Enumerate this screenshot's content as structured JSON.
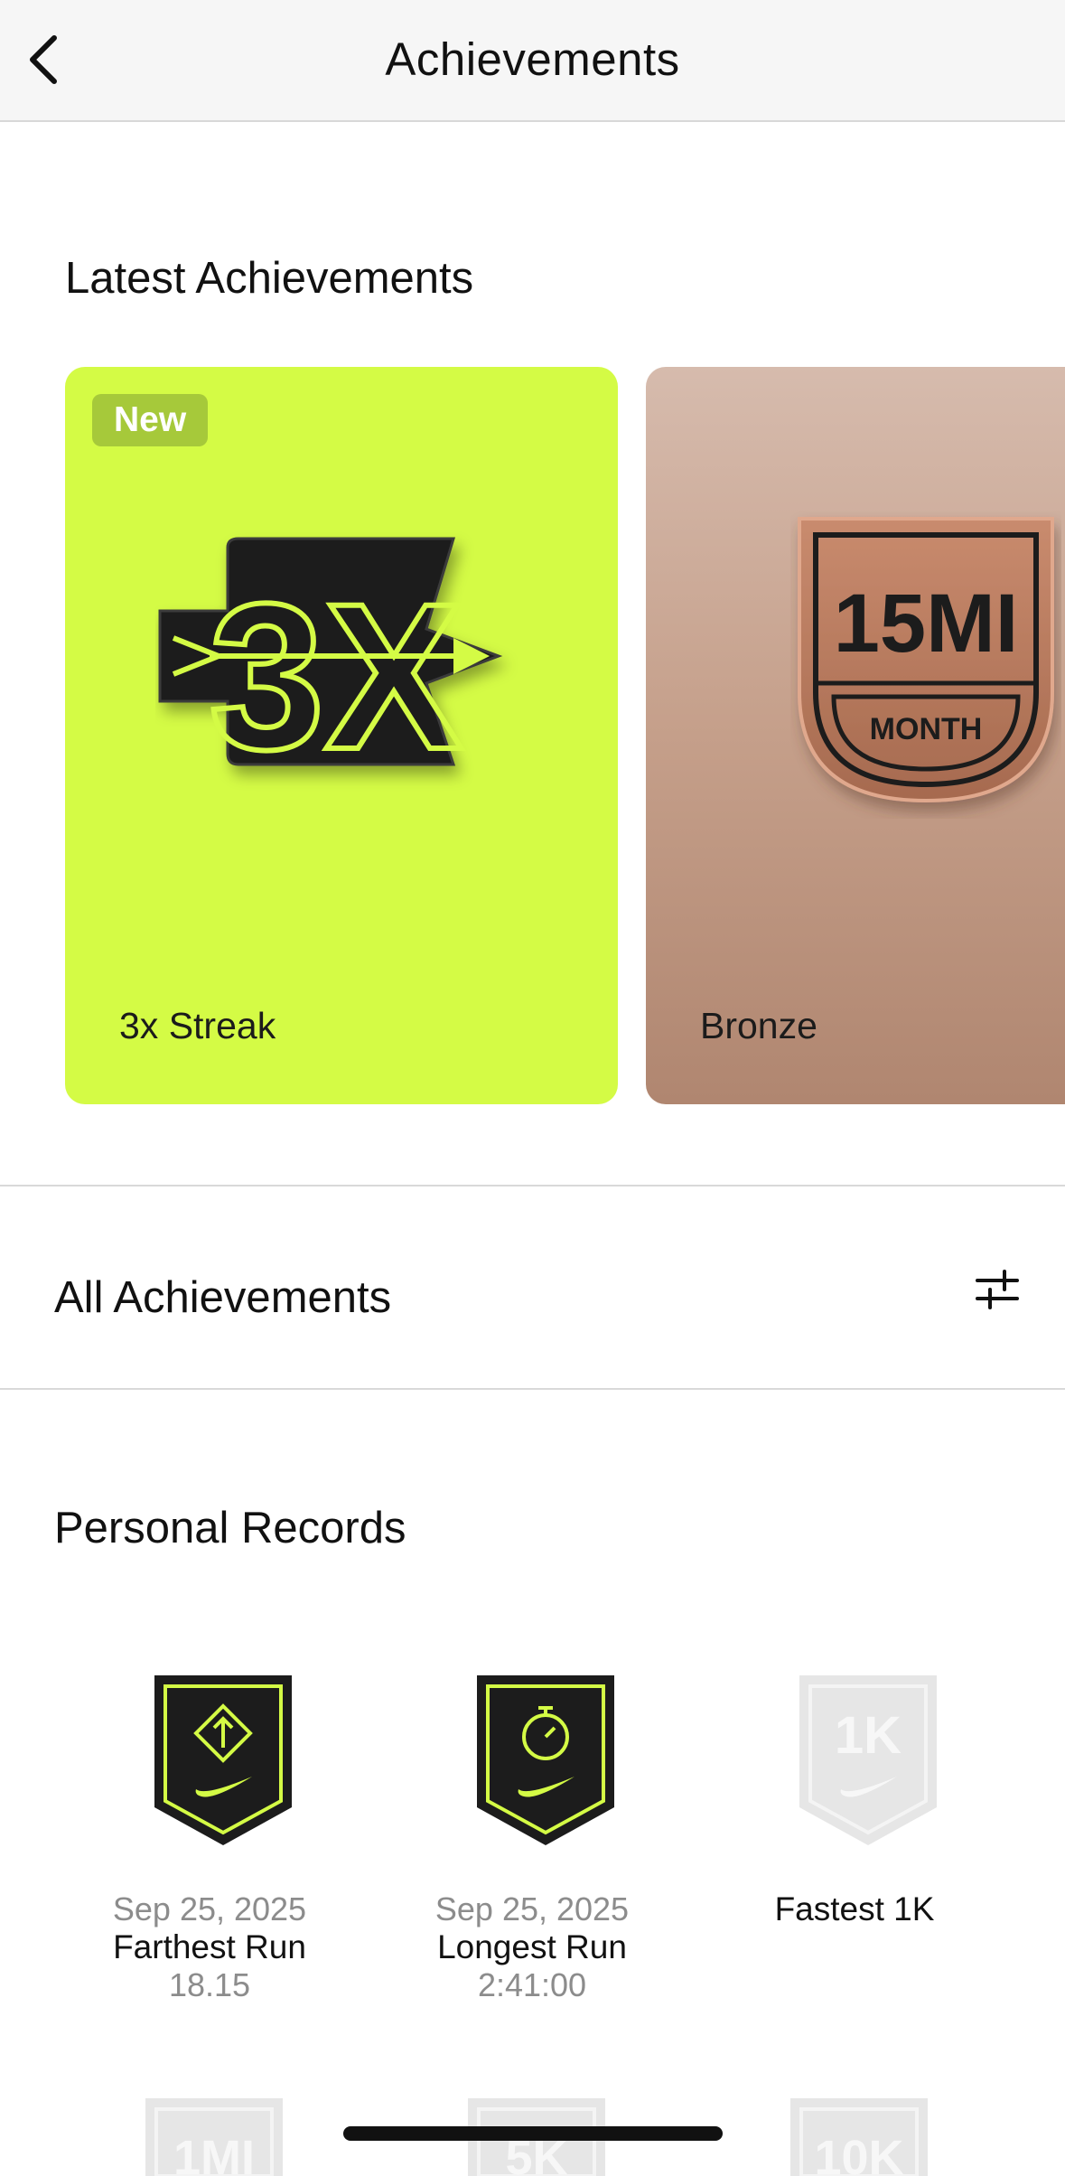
{
  "nav": {
    "title": "Achievements",
    "back_icon": "chevron-left-icon"
  },
  "latest": {
    "title": "Latest Achievements",
    "cards": [
      {
        "badge": "New",
        "label": "3x Streak",
        "art_text": "3X",
        "background": "#d4fb45"
      },
      {
        "label": "Bronze",
        "art_text": "15MI",
        "art_subtext": "MONTH",
        "background": "#c59f8a"
      }
    ]
  },
  "all": {
    "title": "All Achievements",
    "filter_icon": "sliders-icon"
  },
  "personal_records": {
    "title": "Personal Records",
    "items": [
      {
        "date": "Sep 25, 2025",
        "name": "Farthest Run",
        "value": "18.15",
        "icon": "farthest-run-badge-icon"
      },
      {
        "date": "Sep 25, 2025",
        "name": "Longest Run",
        "value": "2:41:00",
        "icon": "longest-run-badge-icon"
      },
      {
        "name": "Fastest 1K",
        "icon": "fastest-1k-badge-icon",
        "badge_text": "1K"
      }
    ],
    "next_row_badges": [
      "1MI",
      "5K",
      "10K"
    ]
  },
  "colors": {
    "accent": "#d4fb45",
    "bronze": "#b3775a",
    "badge_dark": "#1c1c1c",
    "locked": "#e6e6e6"
  }
}
